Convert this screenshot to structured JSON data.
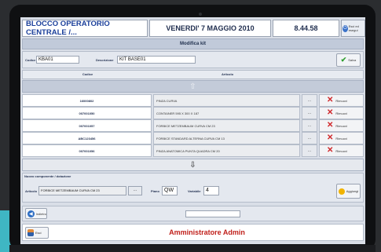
{
  "header": {
    "app_title": "BLOCCO OPERATORIO CENTRALE /...",
    "date": "VENERDI' 7 MAGGIO 2010",
    "time": "8.44.58",
    "exit_label": "Esci ed esegui"
  },
  "page_title": "Modifica kit",
  "kit": {
    "code_label": "Codice",
    "code_value": "KBA01",
    "desc_label": "Descrizione",
    "desc_value": "KIT BASE01",
    "save_label": "Salva"
  },
  "table": {
    "col_code": "Codice",
    "col_article": "Articolo",
    "remove_label": "Rimuovi",
    "dots_label": "...",
    "rows": [
      {
        "code": "16000802",
        "article": "PINZA CURVA"
      },
      {
        "code": "007001050",
        "article": "CONTAINER 595 X 300 X 187"
      },
      {
        "code": "007001057",
        "article": "FORBICE METZEMBAUM CURVA CM 23"
      },
      {
        "code": "ABC123456",
        "article": "FORBICE STANDARD ALTERNA CURVA CM 13"
      },
      {
        "code": "007001056",
        "article": "PINZA ANATOMICA PUNTA QUADRA CM 20"
      }
    ]
  },
  "new_component": {
    "header": "Nuovo componente / dotazione",
    "article_label": "Articolo",
    "article_value": "FORBICE METZEMBAUM CURVA CM 23",
    "dots_label": "...",
    "plan_label": "Piano",
    "plan_value": "QW",
    "variable_label": "Variabile",
    "variable_value": "4",
    "add_label": "Aggiungi"
  },
  "nav": {
    "back_label": "Indietro",
    "user_button_label": "Esci"
  },
  "footer": {
    "user_text": "Amministratore Admin"
  },
  "colors": {
    "accent_blue": "#1b3f9a",
    "remove_red": "#d0282b",
    "user_red": "#c0201b",
    "save_green": "#2f9e2f"
  }
}
